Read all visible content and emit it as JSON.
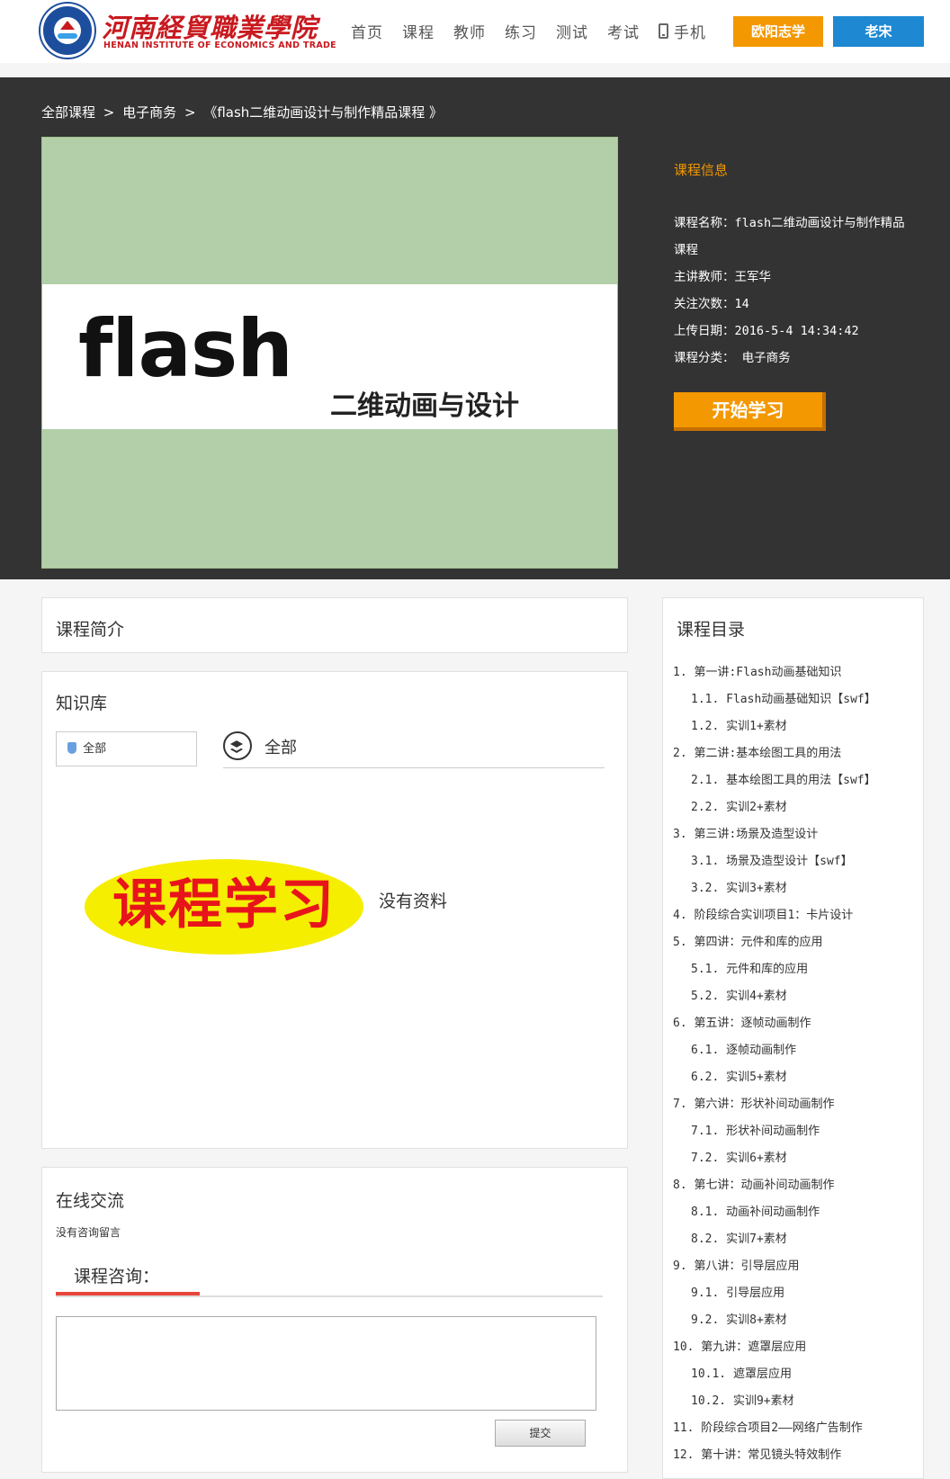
{
  "header": {
    "logo_cn": "河南経貿職業學院",
    "logo_en": "HENAN INSTITUTE OF ECONOMICS AND TRADE",
    "nav": [
      "首页",
      "课程",
      "教师",
      "练习",
      "测试",
      "考试"
    ],
    "nav_phone": "手机",
    "user_btn_1": "欧阳志学",
    "user_btn_2": "老宋"
  },
  "breadcrumb": {
    "all_courses": "全部课程",
    "sep1": ">",
    "category": "电子商务",
    "sep2": ">",
    "course": "《flash二维动画设计与制作精品课程 》"
  },
  "cover": {
    "title": "flash",
    "subtitle": "二维动画与设计"
  },
  "course_info": {
    "heading": "课程信息",
    "name_row": "课程名称：flash二维动画设计与制作精品",
    "name_row_cont": "课程",
    "teacher_row": "主讲教师：王军华",
    "follow_row": "关注次数：14",
    "upload_row": "上传日期：2016-5-4 14:34:42",
    "category_row": "课程分类： 电子商务",
    "start_button": "开始学习"
  },
  "intro": {
    "title": "课程简介"
  },
  "knowledge": {
    "title": "知识库",
    "tree_root": "全部",
    "header_label": "全部",
    "image_text": "课程学习",
    "empty_text": "没有资料"
  },
  "online": {
    "title": "在线交流",
    "no_messages": "没有咨询留言",
    "consult_label": "课程咨询：",
    "submit": "提交"
  },
  "catalog": {
    "title": "课程目录",
    "items": [
      {
        "text": "1.  第一讲:Flash动画基础知识",
        "sub": false
      },
      {
        "text": "1.1.  Flash动画基础知识【swf】",
        "sub": true
      },
      {
        "text": "1.2.  实训1+素材",
        "sub": true
      },
      {
        "text": "2.  第二讲:基本绘图工具的用法",
        "sub": false
      },
      {
        "text": "2.1.  基本绘图工具的用法【swf】",
        "sub": true
      },
      {
        "text": "2.2.  实训2+素材",
        "sub": true
      },
      {
        "text": "3.  第三讲:场景及造型设计",
        "sub": false
      },
      {
        "text": "3.1.  场景及造型设计【swf】",
        "sub": true
      },
      {
        "text": "3.2.  实训3+素材",
        "sub": true
      },
      {
        "text": "4.  阶段综合实训项目1：卡片设计",
        "sub": false
      },
      {
        "text": "5.  第四讲：元件和库的应用",
        "sub": false
      },
      {
        "text": "5.1.  元件和库的应用",
        "sub": true
      },
      {
        "text": "5.2.  实训4+素材",
        "sub": true
      },
      {
        "text": "6.  第五讲：逐帧动画制作",
        "sub": false
      },
      {
        "text": "6.1.  逐帧动画制作",
        "sub": true
      },
      {
        "text": "6.2.  实训5+素材",
        "sub": true
      },
      {
        "text": "7.  第六讲：形状补间动画制作",
        "sub": false
      },
      {
        "text": "7.1.  形状补间动画制作",
        "sub": true
      },
      {
        "text": "7.2.  实训6+素材",
        "sub": true
      },
      {
        "text": "8.  第七讲：动画补间动画制作",
        "sub": false
      },
      {
        "text": "8.1.  动画补间动画制作",
        "sub": true
      },
      {
        "text": "8.2.  实训7+素材",
        "sub": true
      },
      {
        "text": "9.  第八讲：引导层应用",
        "sub": false
      },
      {
        "text": "9.1.  引导层应用",
        "sub": true
      },
      {
        "text": "9.2.  实训8+素材",
        "sub": true
      },
      {
        "text": "10.  第九讲：遮罩层应用",
        "sub": false
      },
      {
        "text": "10.1.  遮罩层应用",
        "sub": true
      },
      {
        "text": "10.2.  实训9+素材",
        "sub": true
      },
      {
        "text": "11.  阶段综合项目2——网络广告制作",
        "sub": false
      },
      {
        "text": "12.  第十讲：常见镜头特效制作",
        "sub": false
      }
    ]
  }
}
